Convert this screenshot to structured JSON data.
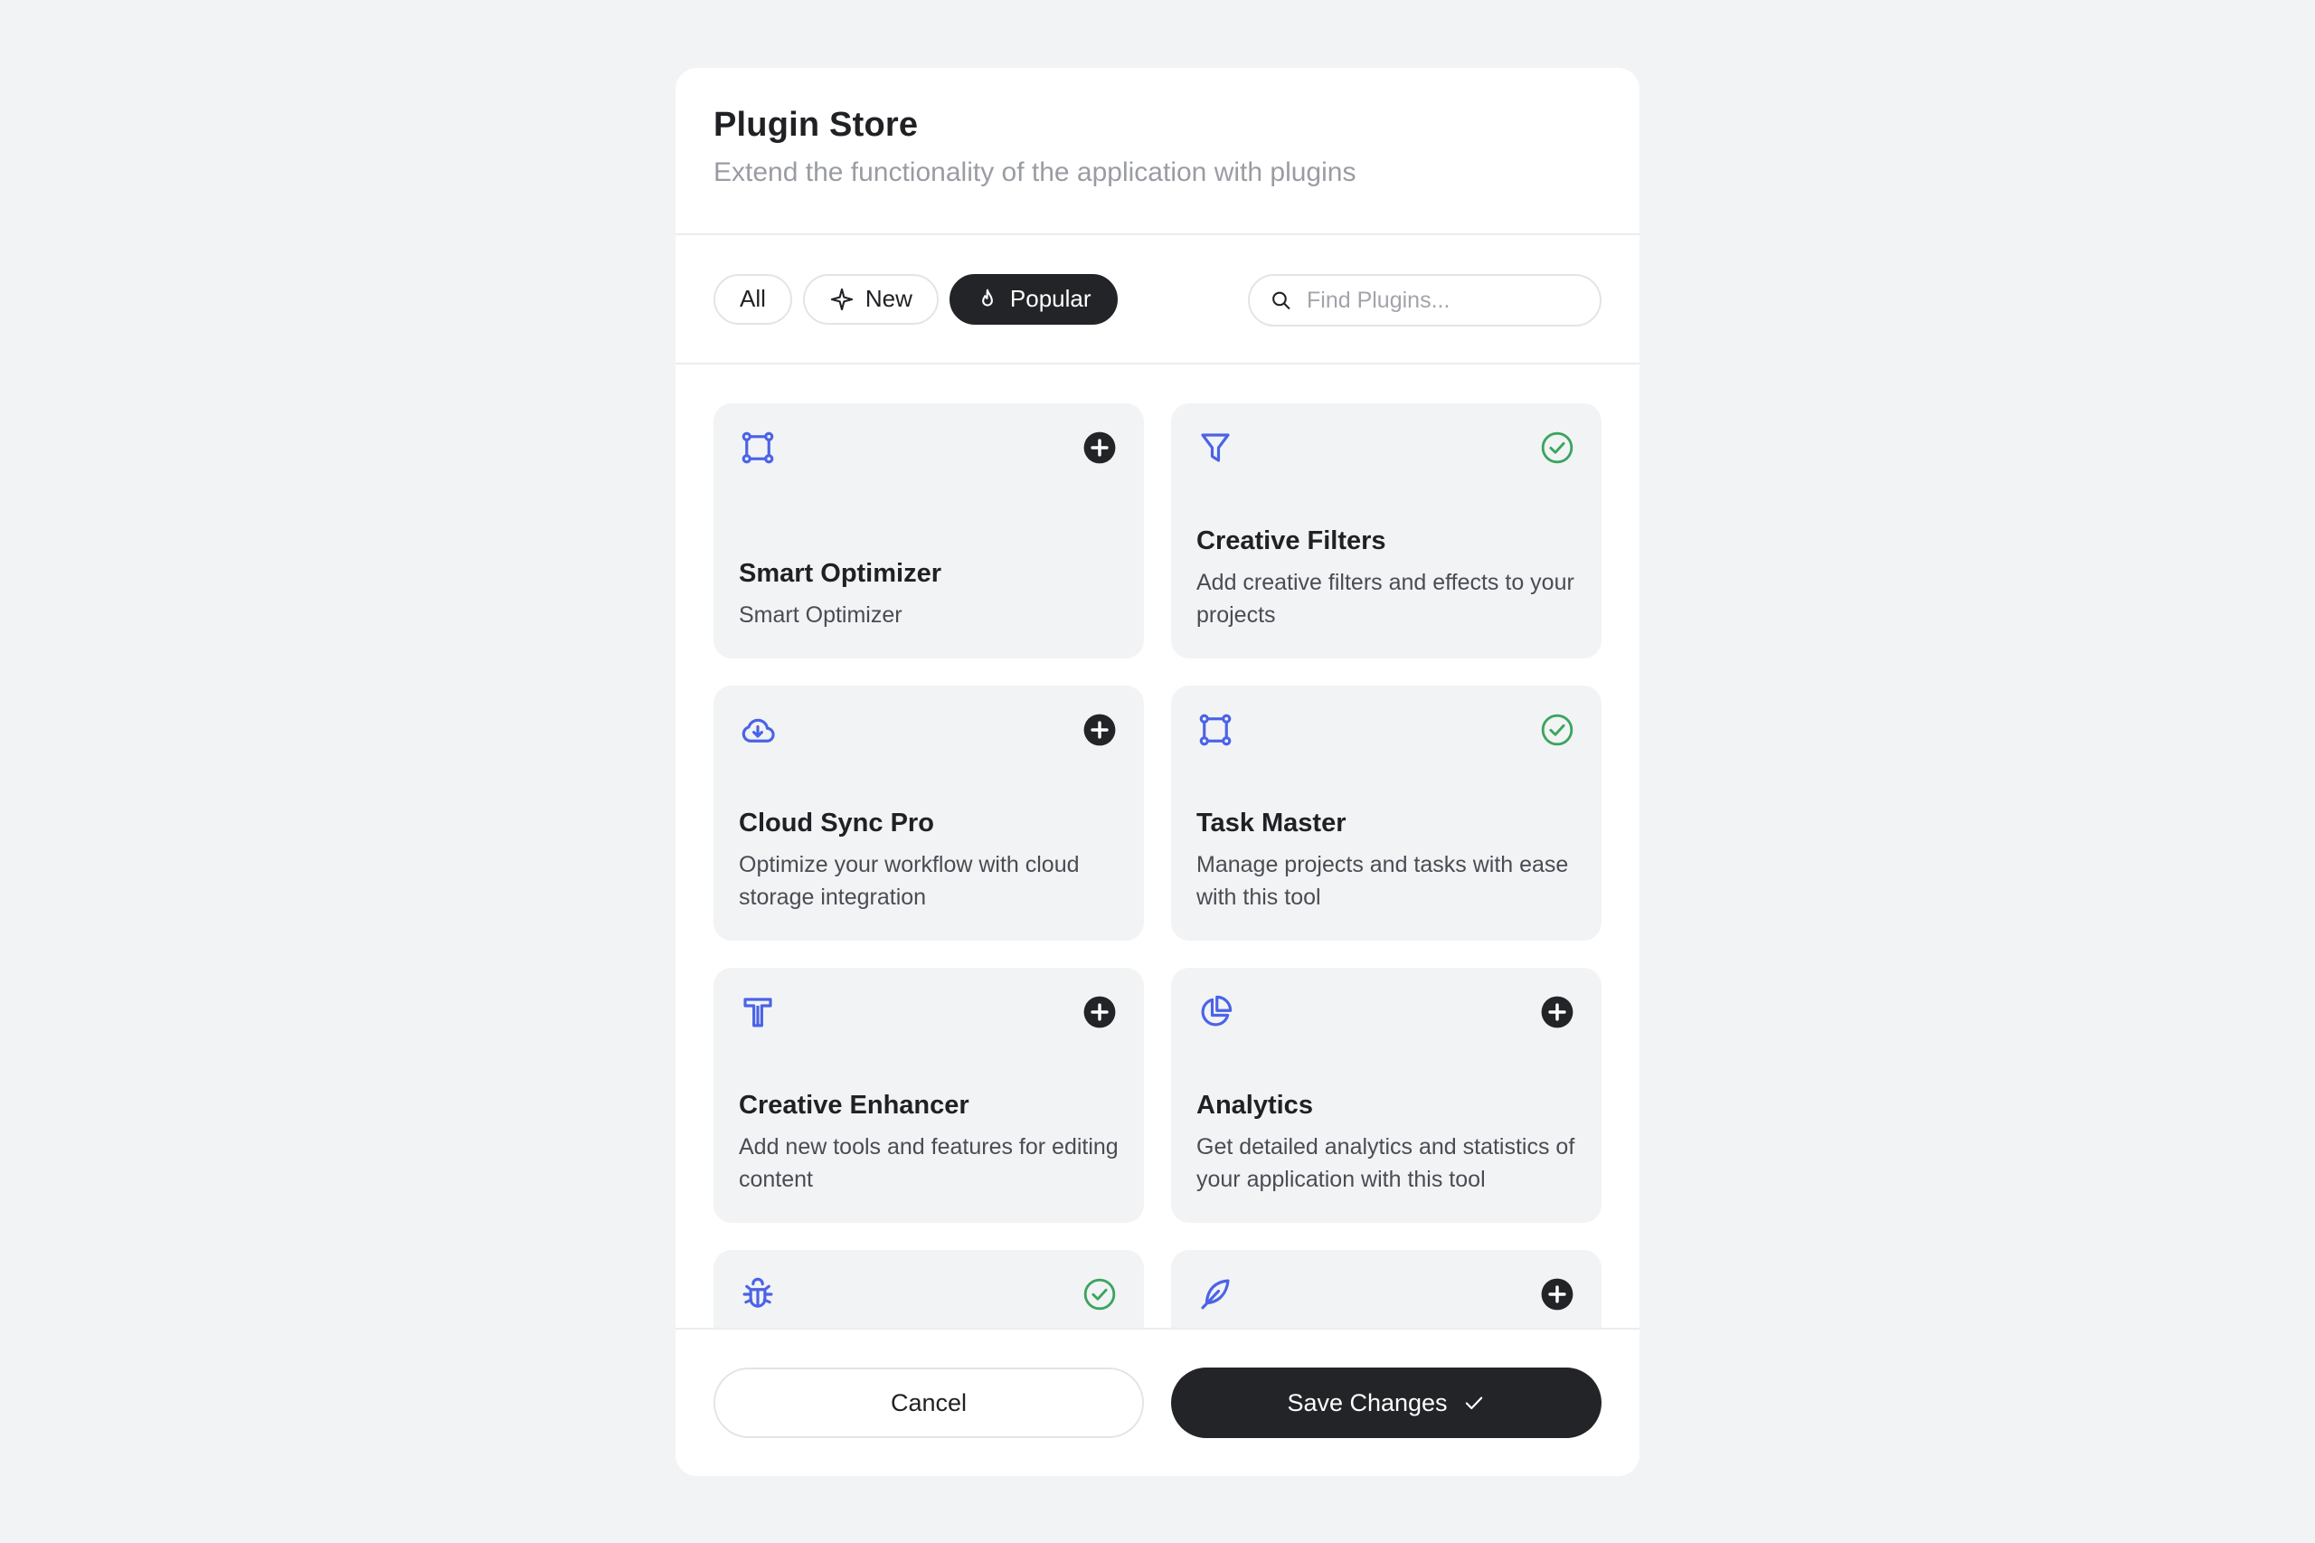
{
  "header": {
    "title": "Plugin Store",
    "subtitle": "Extend the functionality of the application with plugins"
  },
  "filters": [
    {
      "label": "All",
      "icon": null,
      "active": false
    },
    {
      "label": "New",
      "icon": "sparkle-icon",
      "active": false
    },
    {
      "label": "Popular",
      "icon": "flame-icon",
      "active": true
    }
  ],
  "search": {
    "placeholder": "Find Plugins...",
    "value": ""
  },
  "plugins": [
    {
      "name": "Smart Optimizer",
      "description": "Smart Optimizer",
      "icon": "vector-square-icon",
      "status": "add"
    },
    {
      "name": "Creative Filters",
      "description": "Add creative filters and effects to your projects",
      "icon": "funnel-icon",
      "status": "installed"
    },
    {
      "name": "Cloud Sync Pro",
      "description": "Optimize your workflow with cloud storage integration",
      "icon": "cloud-download-icon",
      "status": "add"
    },
    {
      "name": "Task Master",
      "description": "Manage projects and tasks with ease with this tool",
      "icon": "vector-square-icon",
      "status": "installed"
    },
    {
      "name": "Creative Enhancer",
      "description": "Add new tools and features for editing content",
      "icon": "text-tool-icon",
      "status": "add"
    },
    {
      "name": "Analytics",
      "description": "Get detailed analytics and statistics of your application with this tool",
      "icon": "pie-chart-icon",
      "status": "add"
    },
    {
      "name": "",
      "description": "",
      "icon": "bug-icon",
      "status": "installed"
    },
    {
      "name": "",
      "description": "",
      "icon": "feather-icon",
      "status": "add"
    }
  ],
  "footer": {
    "cancel_label": "Cancel",
    "save_label": "Save Changes"
  },
  "colors": {
    "accent_blue": "#4a63e7",
    "installed_green": "#3aa55d",
    "dark": "#232427",
    "card_bg": "#f2f3f5"
  }
}
